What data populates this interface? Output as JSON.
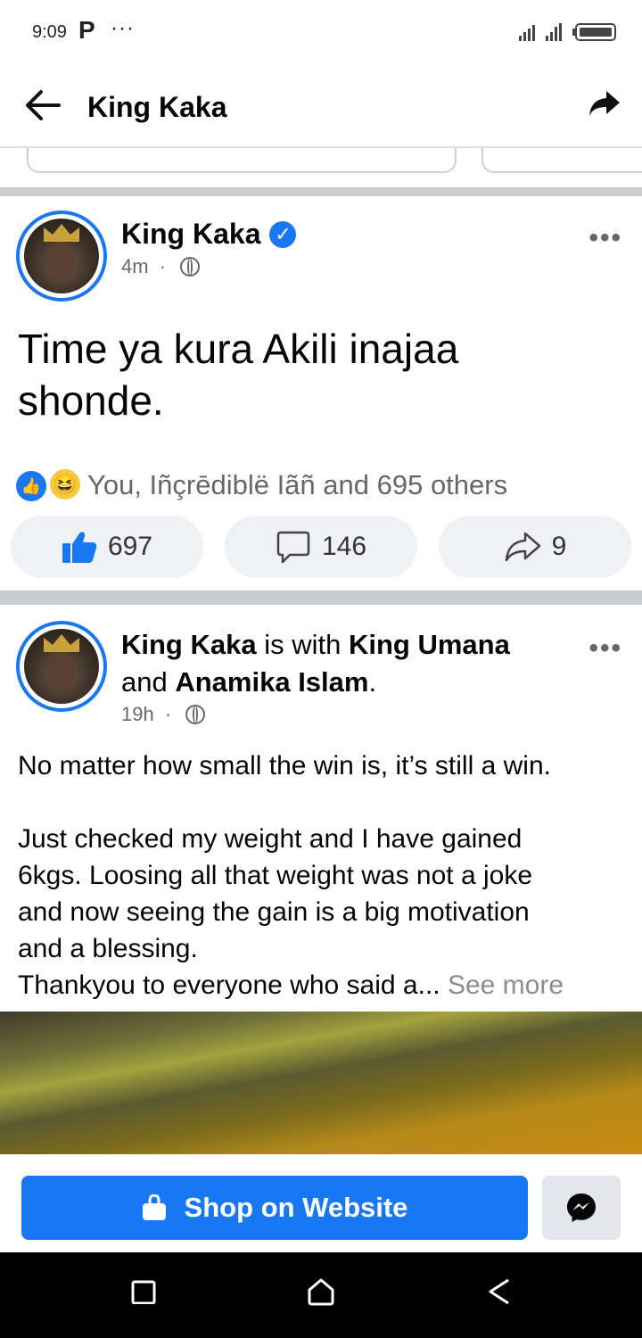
{
  "status_bar": {
    "time": "9:09",
    "notif_letter": "P",
    "notif_more": "···"
  },
  "app_bar": {
    "title": "King Kaka"
  },
  "post1": {
    "author": "King Kaka",
    "time": "4m",
    "dot": "·",
    "text_line1": "Time ya kura Akili inajaa",
    "text_line2": "shonde.",
    "reactions_text": "You, Iñçrēdiblë Iãñ and 695 others",
    "likes": "697",
    "comments": "146",
    "shares": "9"
  },
  "post2": {
    "author": "King Kaka",
    "with_text": "is with",
    "tagged1": "King Umana",
    "and_text": "and",
    "tagged2": "Anamika Islam",
    "period": ".",
    "time": "19h",
    "dot": "·",
    "line1": "No matter how small the win is, it’s still a win.",
    "line2": "Just checked my weight and I have gained",
    "line3": "6kgs. Loosing all that weight was not a joke",
    "line4": "and now seeing the gain is a big motivation",
    "line5": "and a blessing.",
    "line6": "Thankyou to everyone who said a...",
    "see_more": "See more"
  },
  "shop_button": {
    "label": "Shop on Website"
  },
  "icons": [
    "back-arrow-icon",
    "share-icon",
    "verified-icon",
    "globe-icon",
    "more-icon",
    "like-icon",
    "comment-icon",
    "share-outline-icon",
    "shopping-bag-icon",
    "messenger-icon",
    "nav-square-icon",
    "nav-home-icon",
    "nav-back-icon"
  ],
  "colors": {
    "accent": "#1877f2",
    "muted": "#65676b",
    "pill_bg": "#eff1f4",
    "divider": "#c9ccd1"
  }
}
